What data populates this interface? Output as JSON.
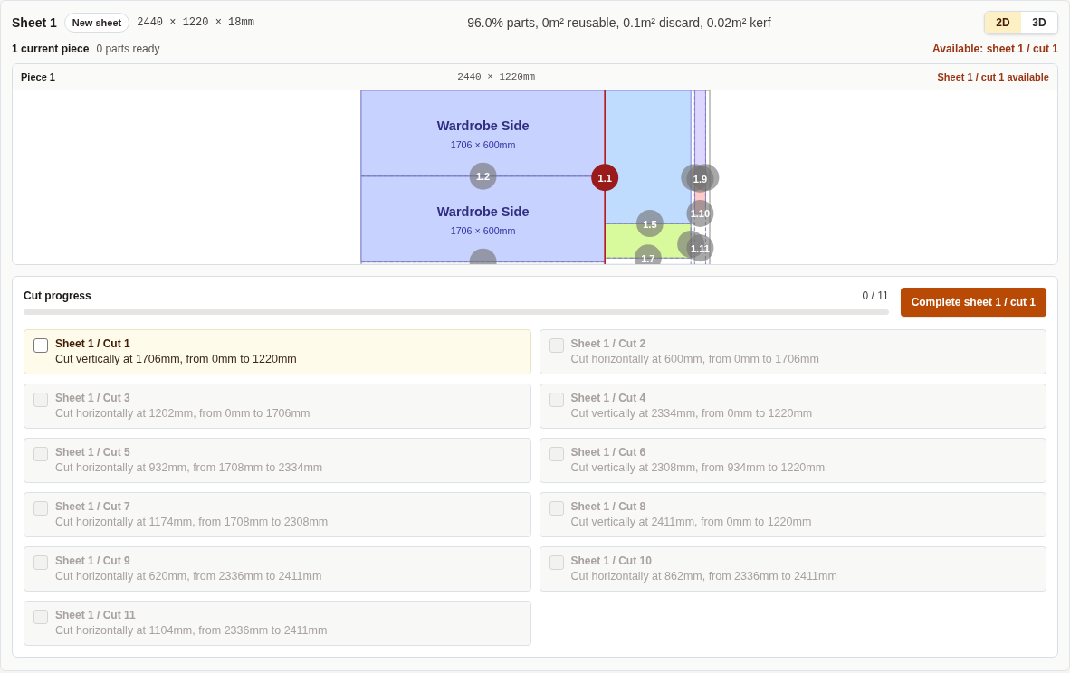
{
  "header": {
    "title": "Sheet 1",
    "badge": "New sheet",
    "dimensions": "2440 × 1220 × 18mm",
    "summary": "96.0% parts, 0m² reusable, 0.1m² discard, 0.02m² kerf",
    "view_toggle": [
      {
        "label": "2D",
        "selected": true
      },
      {
        "label": "3D",
        "selected": false
      }
    ]
  },
  "status": {
    "pieces": "1 current piece",
    "parts_ready": "0 parts ready",
    "available": "Available: sheet 1 / cut 1"
  },
  "piece": {
    "title": "Piece 1",
    "dimensions": "2440 × 1220mm",
    "availability": "Sheet 1 / cut 1 available",
    "parts": [
      {
        "name": "Wardrobe Side",
        "size": "1706 × 600mm",
        "color": "#c7d2fe"
      },
      {
        "name": "Wardrobe Side",
        "size": "1706 × 600mm",
        "color": "#c7d2fe"
      },
      {
        "color": "#bfdbfe"
      },
      {
        "color": "#d9f99d"
      },
      {
        "color": "#ddd6fe"
      },
      {
        "color": "#fecaca"
      }
    ],
    "markers": [
      {
        "label": "1.2",
        "active": false
      },
      {
        "label": "1.1",
        "active": true
      },
      {
        "active": false
      },
      {
        "label": "1.9",
        "active": false
      },
      {
        "active": false
      },
      {
        "label": "1.5",
        "active": false
      },
      {
        "label": "1.10",
        "active": false
      },
      {
        "active": false
      },
      {
        "label": "1.7",
        "active": false
      },
      {
        "active": false
      },
      {
        "label": "1.11",
        "active": false
      }
    ]
  },
  "cut_progress": {
    "title": "Cut progress",
    "count": "0 / 11",
    "level": 0,
    "button": "Complete sheet 1 / cut 1",
    "cuts": [
      {
        "title": "Sheet 1 / Cut 1",
        "description": "Cut vertically at 1706mm, from 0mm to 1220mm",
        "checked": false,
        "disabled": false
      },
      {
        "title": "Sheet 1 / Cut 2",
        "description": "Cut horizontally at 600mm, from 0mm to 1706mm",
        "checked": false,
        "disabled": true
      },
      {
        "title": "Sheet 1 / Cut 3",
        "description": "Cut horizontally at 1202mm, from 0mm to 1706mm",
        "checked": false,
        "disabled": true
      },
      {
        "title": "Sheet 1 / Cut 4",
        "description": "Cut vertically at 2334mm, from 0mm to 1220mm",
        "checked": false,
        "disabled": true
      },
      {
        "title": "Sheet 1 / Cut 5",
        "description": "Cut horizontally at 932mm, from 1708mm to 2334mm",
        "checked": false,
        "disabled": true
      },
      {
        "title": "Sheet 1 / Cut 6",
        "description": "Cut vertically at 2308mm, from 934mm to 1220mm",
        "checked": false,
        "disabled": true
      },
      {
        "title": "Sheet 1 / Cut 7",
        "description": "Cut horizontally at 1174mm, from 1708mm to 2308mm",
        "checked": false,
        "disabled": true
      },
      {
        "title": "Sheet 1 / Cut 8",
        "description": "Cut vertically at 2411mm, from 0mm to 1220mm",
        "checked": false,
        "disabled": true
      },
      {
        "title": "Sheet 1 / Cut 9",
        "description": "Cut horizontally at 620mm, from 2336mm to 2411mm",
        "checked": false,
        "disabled": true
      },
      {
        "title": "Sheet 1 / Cut 10",
        "description": "Cut horizontally at 862mm, from 2336mm to 2411mm",
        "checked": false,
        "disabled": true
      },
      {
        "title": "Sheet 1 / Cut 11",
        "description": "Cut horizontally at 1104mm, from 2336mm to 2411mm",
        "checked": false,
        "disabled": true
      }
    ]
  }
}
